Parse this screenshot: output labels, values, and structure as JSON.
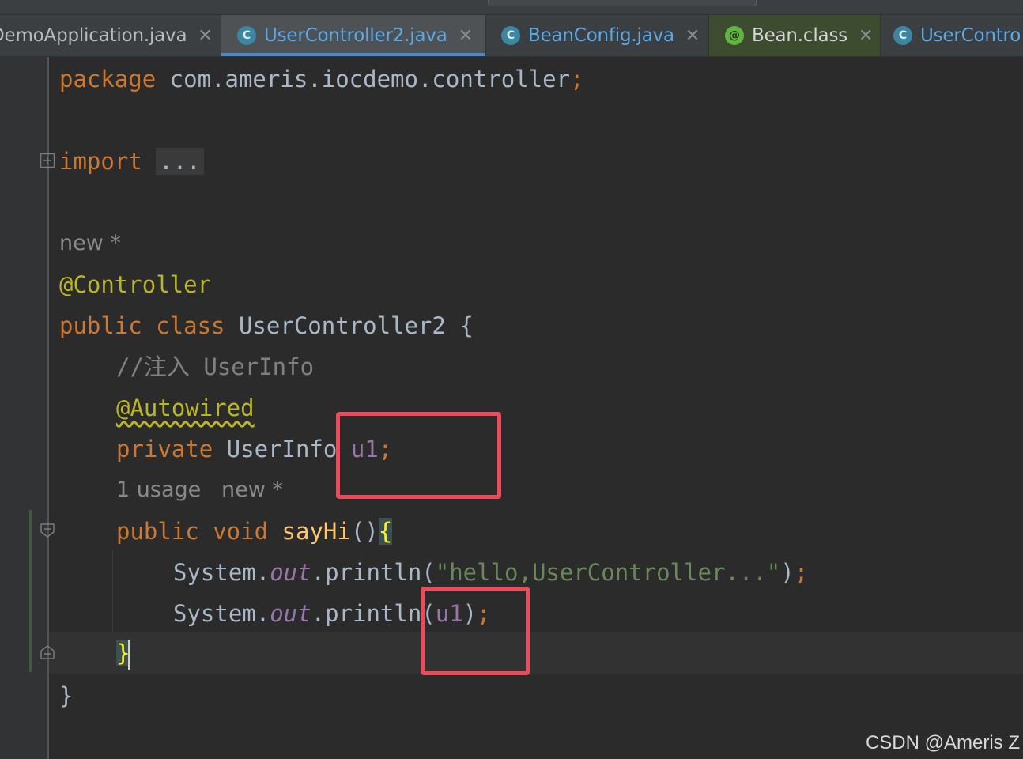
{
  "tabs": [
    {
      "label": "DemoApplication.java",
      "close": "✕"
    },
    {
      "label": "UserController2.java",
      "icon": "C",
      "close": "✕"
    },
    {
      "label": "BeanConfig.java",
      "icon": "C",
      "close": "✕"
    },
    {
      "label": "Bean.class",
      "icon": "@",
      "close": "✕"
    },
    {
      "label": "UserContro",
      "icon": "C"
    }
  ],
  "code": {
    "l1_kw": "package",
    "l1_pkg": " com.ameris.iocdemo.controller",
    "l1_semi": ";",
    "l3_kw": "import",
    "l3_fold": "...",
    "hint_class": "new *",
    "l6_ann": "@Controller",
    "l7_kw": "public class",
    "l7_name": " UserController2 {",
    "l8_cmt": "//注入 UserInfo",
    "l9_ann": "@Autowired",
    "l10_kw": "private",
    "l10_type": " UserInfo ",
    "l10_field": "u1",
    "l10_semi": ";",
    "hint_usage": "1 usage",
    "hint_new": "new *",
    "l11_kw": "public void",
    "l11_fn": "sayHi",
    "l11_parens": "()",
    "l11_brace": "{",
    "l12_sys": "System.",
    "l12_out": "out",
    "l12_call": ".println(",
    "l12_str": "\"hello,UserController...\"",
    "l12_close": ")",
    "l12_semi": ";",
    "l13_sys": "System.",
    "l13_out": "out",
    "l13_call": ".println(",
    "l13_arg": "u1",
    "l13_close": ")",
    "l13_semi": ";",
    "l14_brace": "}",
    "l15_brace": "}"
  },
  "watermark": "CSDN @Ameris Z",
  "colors": {
    "keyword": "#cc7832",
    "annotation": "#bbb529",
    "field": "#9876aa",
    "string": "#6a8759",
    "highlight_box": "#f04a5a"
  }
}
